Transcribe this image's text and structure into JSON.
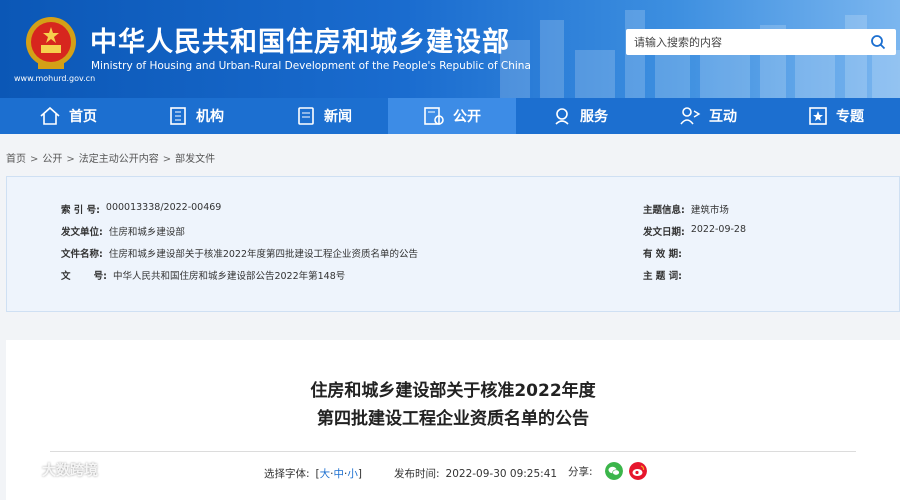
{
  "header": {
    "title_cn": "中华人民共和国住房和城乡建设部",
    "title_en": "Ministry of Housing and Urban-Rural Development of the People's Republic of China",
    "site_url": "www.mohurd.gov.cn",
    "search": {
      "placeholder": "请输入搜索的内容",
      "icon": "search-icon"
    }
  },
  "nav": {
    "items": [
      {
        "label": "首页",
        "icon": "home-icon"
      },
      {
        "label": "机构",
        "icon": "building-icon"
      },
      {
        "label": "新闻",
        "icon": "news-icon"
      },
      {
        "label": "公开",
        "icon": "disclosure-icon",
        "active": true
      },
      {
        "label": "服务",
        "icon": "service-icon"
      },
      {
        "label": "互动",
        "icon": "interaction-icon"
      },
      {
        "label": "专题",
        "icon": "topic-icon"
      }
    ]
  },
  "breadcrumb": [
    "首页",
    "公开",
    "法定主动公开内容",
    "部发文件"
  ],
  "meta": {
    "index_label": "索 引 号:",
    "index_value": "000013338/2022-00469",
    "issuer_label": "发文单位:",
    "issuer_value": "住房和城乡建设部",
    "filename_label": "文件名称:",
    "filename_value": "住房和城乡建设部关于核准2022年度第四批建设工程企业资质名单的公告",
    "docno_label": "文       号:",
    "docno_value": "中华人民共和国住房和城乡建设部公告2022年第148号",
    "topic_label": "主题信息:",
    "topic_value": "建筑市场",
    "date_label": "发文日期:",
    "date_value": "2022-09-28",
    "validity_label": "有 效 期:",
    "validity_value": "",
    "keywords_label": "主 题 词:",
    "keywords_value": ""
  },
  "article": {
    "title_line1": "住房和城乡建设部关于核准2022年度",
    "title_line2": "第四批建设工程企业资质名单的公告",
    "font_label": "选择字体:",
    "font_open": "[",
    "font_large": "大",
    "font_medium": "中",
    "font_small": "小",
    "font_close": "]",
    "font_sep": "·",
    "publish_label": "发布时间:",
    "publish_value": "2022-09-30 09:25:41",
    "share_label": "分享:",
    "colors": {
      "wechat": "#3bb54a",
      "weibo": "#e6162d"
    }
  },
  "watermark": "大数跨境",
  "colors": {
    "nav": "#1c6fd0",
    "nav_active": "#3d8ce6",
    "meta_bg": "#eef4fc"
  }
}
